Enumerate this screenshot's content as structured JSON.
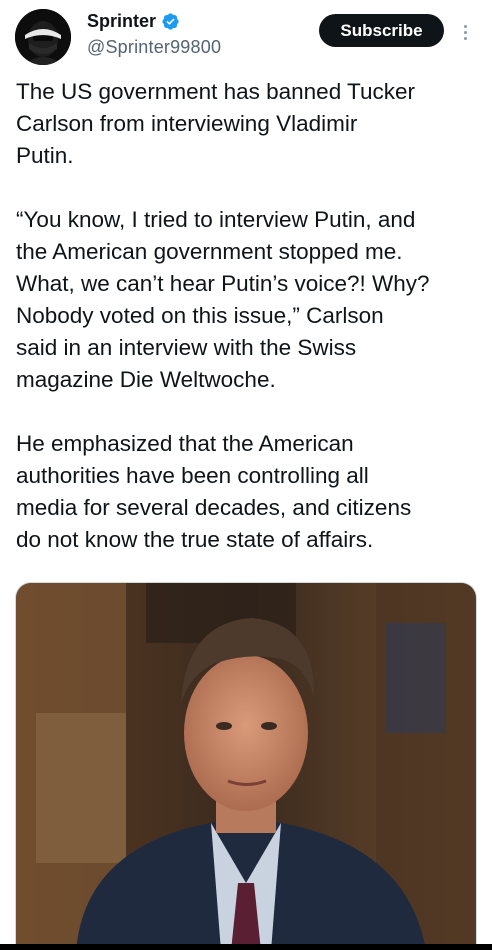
{
  "author": {
    "display_name": "Sprinter",
    "handle": "@Sprinter99800",
    "verified": true,
    "avatar_icon": "masked-face-avatar"
  },
  "actions": {
    "subscribe_label": "Subscribe",
    "more_icon": "more-vertical-icon"
  },
  "tweet": {
    "paragraphs": [
      "The US government has banned Tucker\nCarlson from interviewing Vladimir\nPutin.",
      "“You know, I tried to interview Putin, and\nthe American government stopped me.\nWhat, we can’t hear Putin’s voice?! Why?\nNobody voted on this issue,” Carlson\nsaid in an interview with the Swiss\nmagazine Die Weltwoche.",
      "He emphasized that the American\nauthorities have been controlling all\nmedia for several decades, and citizens\ndo not know the true state of affairs."
    ]
  },
  "colors": {
    "verified_badge": "#1d9bf0",
    "subscribe_bg": "#0f1419",
    "text": "#0f1419",
    "secondary_text": "#536471"
  }
}
